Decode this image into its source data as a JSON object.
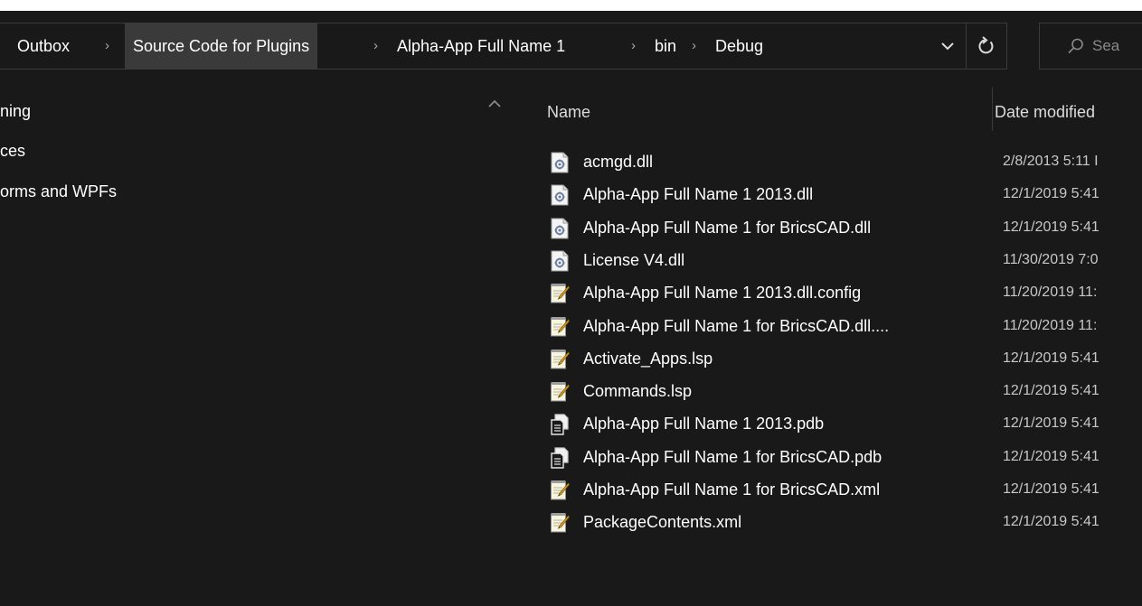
{
  "breadcrumb": {
    "items": [
      "Outbox",
      "Source Code for Plugins",
      "Alpha-App Full Name 1",
      "bin",
      "Debug"
    ],
    "separator": "›"
  },
  "search": {
    "placeholder": "Sea"
  },
  "nav": {
    "items": [
      "ning",
      "ces",
      "orms and WPFs"
    ]
  },
  "columns": {
    "name": "Name",
    "date_modified": "Date modified"
  },
  "files": [
    {
      "name": "acmgd.dll",
      "date": "2/8/2013 5:11 I",
      "icon": "dll-file-icon"
    },
    {
      "name": "Alpha-App Full Name 1 2013.dll",
      "date": "12/1/2019 5:41",
      "icon": "dll-file-icon"
    },
    {
      "name": "Alpha-App Full Name 1 for BricsCAD.dll",
      "date": "12/1/2019 5:41",
      "icon": "dll-file-icon"
    },
    {
      "name": "License V4.dll",
      "date": "11/30/2019 7:0",
      "icon": "dll-file-icon"
    },
    {
      "name": "Alpha-App Full Name 1 2013.dll.config",
      "date": "11/20/2019 11:",
      "icon": "text-file-icon"
    },
    {
      "name": "Alpha-App Full Name 1 for BricsCAD.dll....",
      "date": "11/20/2019 11:",
      "icon": "text-file-icon"
    },
    {
      "name": "Activate_Apps.lsp",
      "date": "12/1/2019 5:41",
      "icon": "text-file-icon"
    },
    {
      "name": "Commands.lsp",
      "date": "12/1/2019 5:41",
      "icon": "text-file-icon"
    },
    {
      "name": "Alpha-App Full Name 1 2013.pdb",
      "date": "12/1/2019 5:41",
      "icon": "pdb-file-icon"
    },
    {
      "name": "Alpha-App Full Name 1 for BricsCAD.pdb",
      "date": "12/1/2019 5:41",
      "icon": "pdb-file-icon"
    },
    {
      "name": "Alpha-App Full Name 1 for BricsCAD.xml",
      "date": "12/1/2019 5:41",
      "icon": "text-file-icon"
    },
    {
      "name": "PackageContents.xml",
      "date": "12/1/2019 5:41",
      "icon": "text-file-icon"
    }
  ],
  "colors": {
    "background": "#191919",
    "border": "#3a3a3a",
    "crumb_hover": "#3a3a3a",
    "text": "#ffffff",
    "muted_text": "#c8c8c8"
  }
}
